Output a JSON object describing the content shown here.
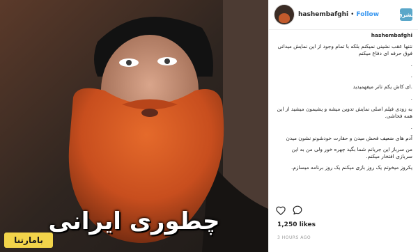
{
  "post": {
    "overlay_text": "چطوری ایرانی",
    "watermark": "بامارتنا"
  },
  "header": {
    "username": "hashembafghi",
    "dot": "•",
    "follow_label": "Follow",
    "brand_mark": "مشرق"
  },
  "caption": {
    "username": "hashembafghi",
    "lines": [
      "نتنها عقب نشینی نمیکنم بلکه با تمام وجود از این نمایش میدانی فوق حرفه ای دفاع میکنم",
      ".",
      ".",
      ".ای کاش یکم تاتر میفهمیدید",
      ".",
      "به زودی فیلم اصلی نمایش تدوین میشه و پشیمون میشید از این همه فحاشی.",
      ".",
      "آدم های ضعیف فحش میدن و حقارت خودشونو نشون میدن",
      "من سرباز این جریانم شما بگید چهره خور ولی من به این سربازی افتخار میکنم.",
      "یکروز میخوتم یک روز بازی میکنم یک روز برنامه میسازم."
    ]
  },
  "actions": {
    "like_icon": "heart-icon",
    "comment_icon": "comment-bubble-icon"
  },
  "likes": "1,250 likes",
  "timestamp": "3 HOURS AGO"
}
